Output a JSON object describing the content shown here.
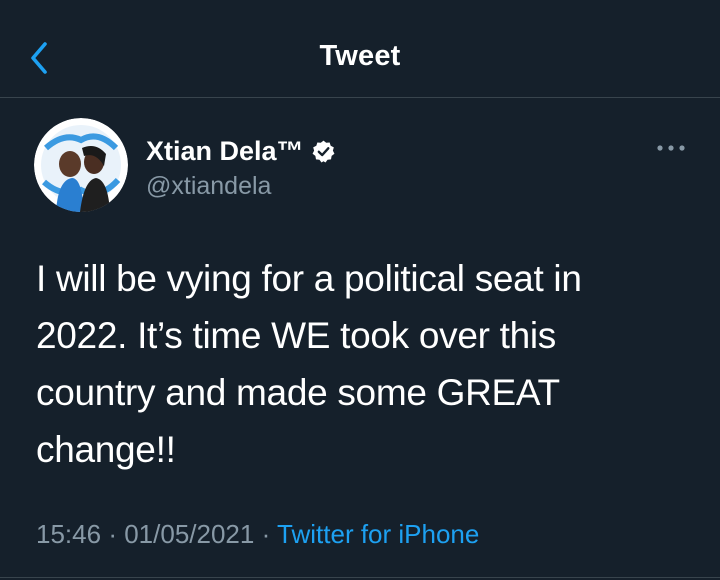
{
  "header": {
    "title": "Tweet",
    "back_icon": "chevron-left-icon"
  },
  "author": {
    "display_name": "Xtian Dela™",
    "handle": "@xtiandela",
    "verified": true
  },
  "tweet": {
    "text": "I will be vying for a political seat in\n2022. It’s time WE took over this\ncountry and made some GREAT\nchange!!",
    "time": "15:46",
    "separator": "·",
    "date": "01/05/2021",
    "source": "Twitter for iPhone"
  },
  "colors": {
    "background": "#15202b",
    "accent": "#1da1f2",
    "secondary_text": "#8899a6",
    "divider": "#38444d"
  }
}
